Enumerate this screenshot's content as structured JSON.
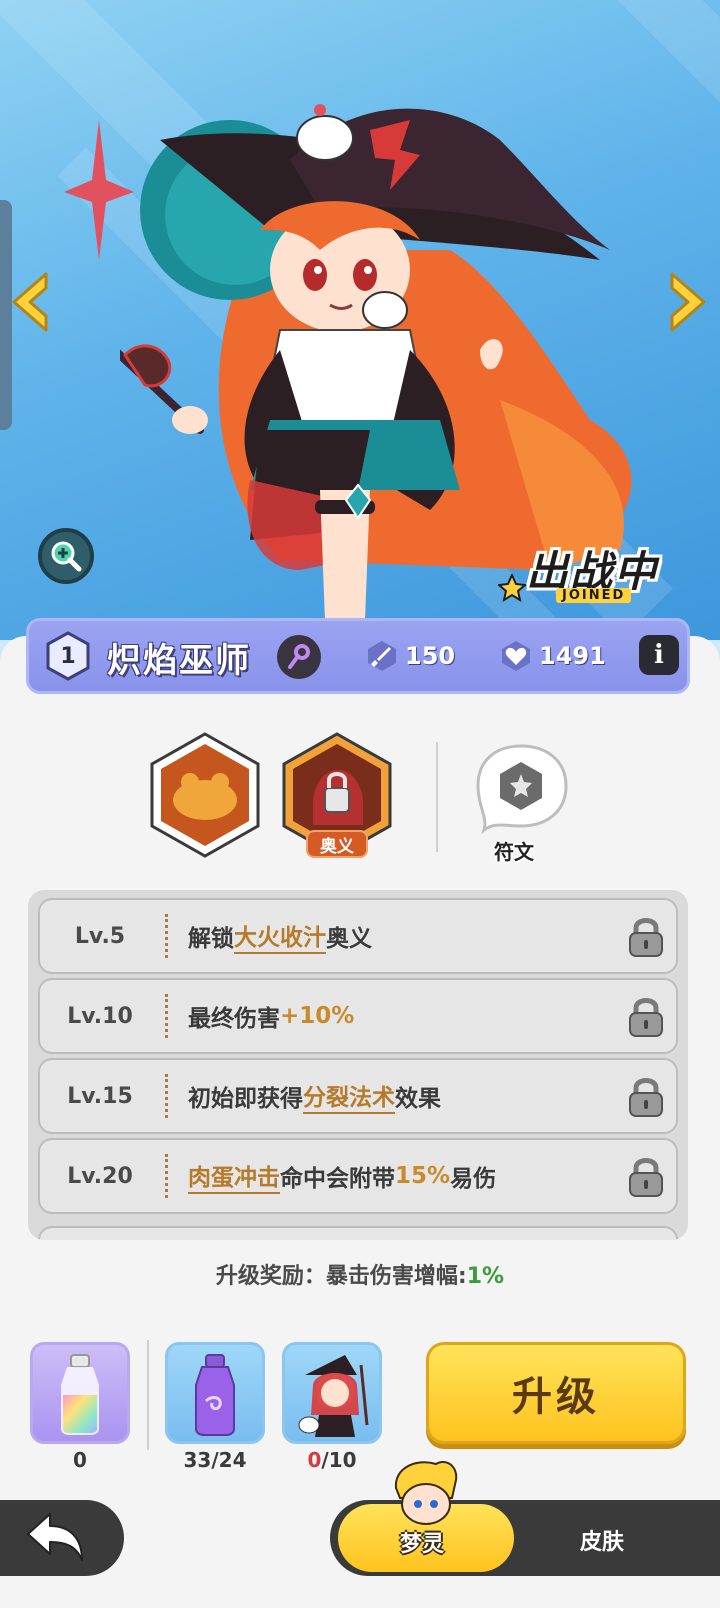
{
  "hero": {
    "name": "炽焰巫师",
    "level": "1",
    "attack": "150",
    "hp": "1491",
    "deploy_badge": "出战中",
    "deploy_sub": "JOINED"
  },
  "skills": {
    "ult_label": "奥义",
    "rune_label": "符文"
  },
  "levels": [
    {
      "lv": "Lv.5",
      "pre": "解锁",
      "hl": "大火收汁",
      "mid": "奥义",
      "num": "",
      "post": ""
    },
    {
      "lv": "Lv.10",
      "pre": "最终伤害",
      "hl": "",
      "mid": "",
      "num": "+10%",
      "post": ""
    },
    {
      "lv": "Lv.15",
      "pre": "初始即获得",
      "hl": "分裂法术",
      "mid": "效果",
      "num": "",
      "post": ""
    },
    {
      "lv": "Lv.20",
      "pre": "",
      "hl": "肉蛋冲击",
      "mid": "命中会附带",
      "num": "15%",
      "post": "易伤"
    }
  ],
  "reward": {
    "label": "升级奖励：暴击伤害增幅:",
    "value": "1%"
  },
  "items": [
    {
      "icon": "rainbow-bottle-icon",
      "count": "0"
    },
    {
      "icon": "purple-potion-icon",
      "count": "33/24"
    },
    {
      "icon": "hero-shard-icon",
      "have": "0",
      "need": "/10"
    }
  ],
  "upgrade_label": "升级",
  "tabs": {
    "active": "梦灵",
    "other": "皮肤"
  },
  "colors": {
    "name_bar": "#8892ea",
    "upgrade": "#ffc31f",
    "highlight": "#b77a2a",
    "reward_green": "#3c9b3a"
  }
}
